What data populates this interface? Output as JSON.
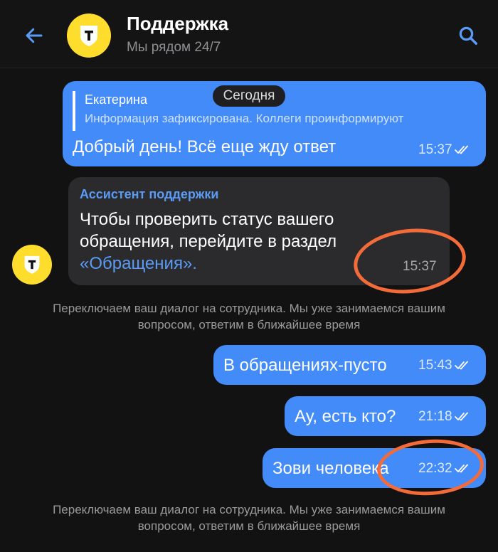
{
  "header": {
    "title": "Поддержка",
    "subtitle": "Мы рядом 24/7"
  },
  "date_separator": "Сегодня",
  "messages": [
    {
      "quote_name": "Екатерина",
      "quote_text": "Информация зафиксирована. Коллеги проинформируют",
      "text": "Добрый день! Всё еще жду ответ",
      "time": "15:37"
    },
    {
      "sender": "Ассистент поддержки",
      "text": "Чтобы проверить статус вашего обращения, перейдите в раздел",
      "link": "«Обращения».",
      "time": "15:37"
    },
    {
      "text": "В обращениях-пусто",
      "time": "15:43"
    },
    {
      "text": "Ау, есть кто?",
      "time": "21:18"
    },
    {
      "text": "Зови человека",
      "time": "22:32"
    }
  ],
  "system_messages": [
    "Переключаем ваш диалог на сотрудника. Мы уже занимаемся вашим вопросом, ответим в ближайшее время",
    "Переключаем ваш диалог на сотрудника. Мы уже занимаемся вашим вопросом, ответим в ближайшее время"
  ],
  "colors": {
    "outgoing_bubble": "#428bf9",
    "incoming_bubble": "#2b2b2d",
    "accent": "#5a9bf6",
    "brand_yellow": "#ffdd2d",
    "annotation": "#f46b3a"
  },
  "icons": {
    "back": "arrow-left-icon",
    "search": "search-icon",
    "brand": "shield-t-icon",
    "read": "double-check-icon"
  }
}
